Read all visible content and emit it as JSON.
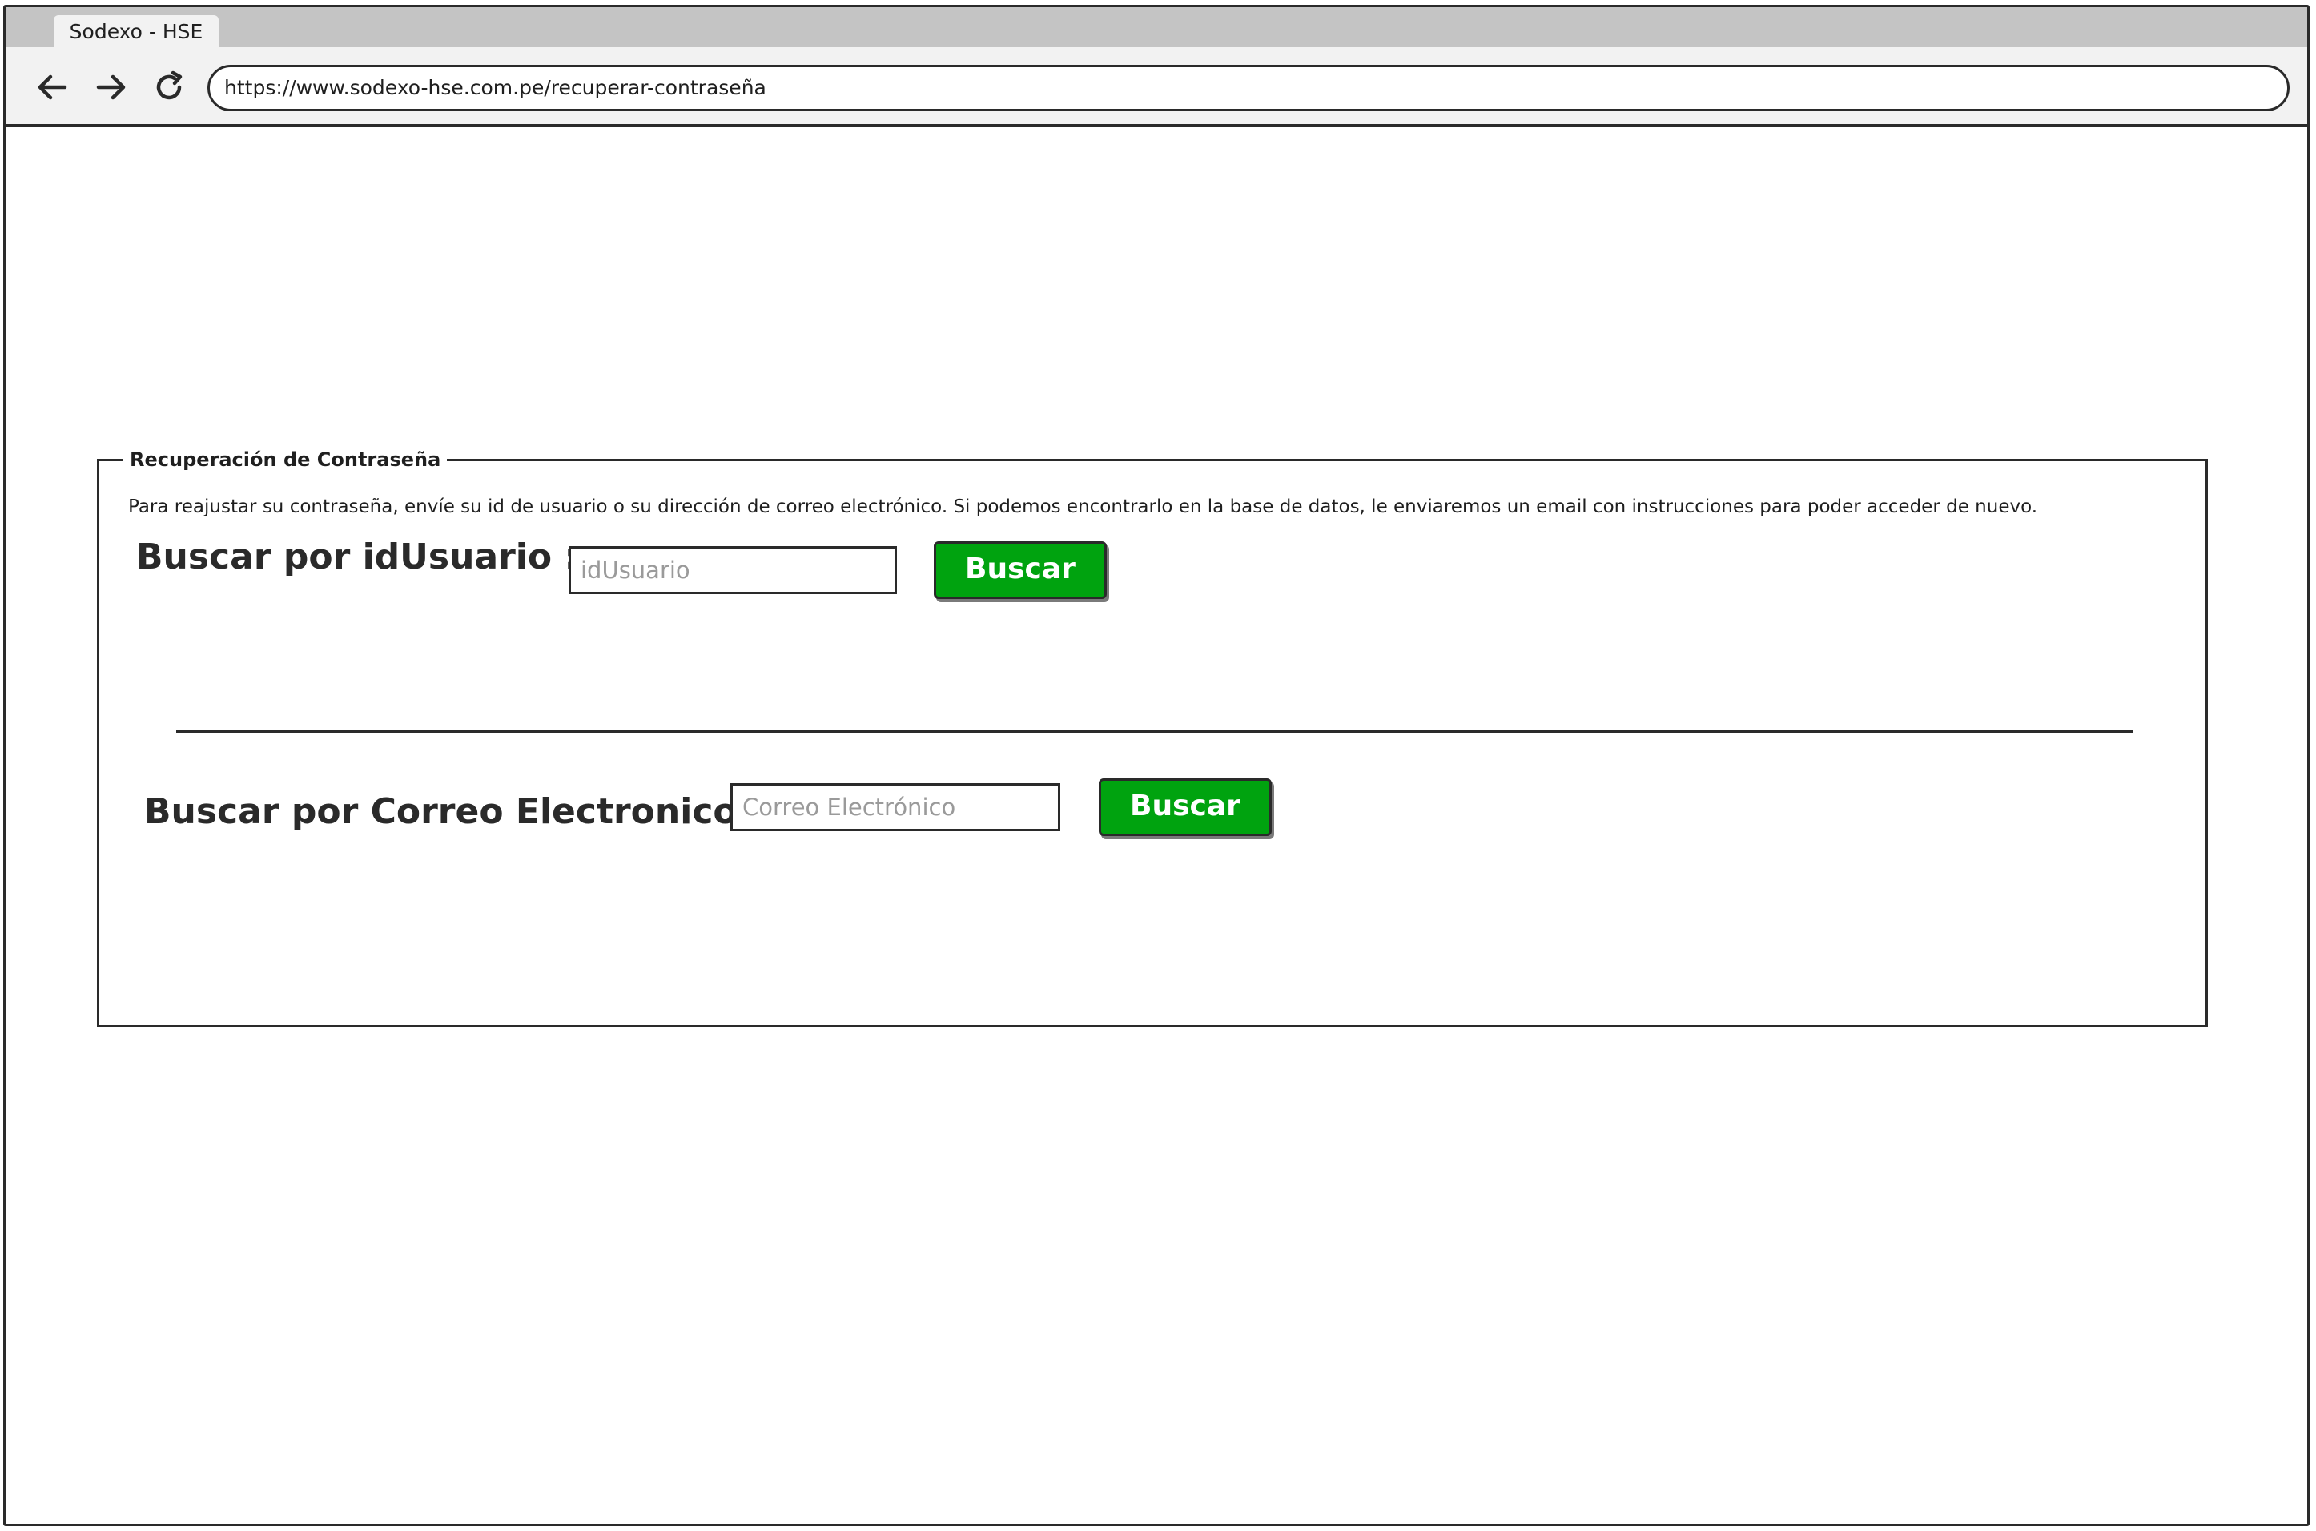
{
  "browser": {
    "tab_title": "Sodexo - HSE",
    "url": "https://www.sodexo-hse.com.pe/recuperar-contraseña",
    "back_icon": "arrow-left-icon",
    "forward_icon": "arrow-right-icon",
    "reload_icon": "reload-icon"
  },
  "form": {
    "legend": "Recuperación de Contraseña",
    "intro": "Para reajustar su contraseña, envíe su id de usuario o su dirección de correo electrónico. Si podemos encontrarlo en la base de datos, le enviaremos un email con instrucciones para poder acceder de nuevo.",
    "by_user": {
      "label": "Buscar por idUsuario :",
      "placeholder": "idUsuario",
      "button_label": "Buscar"
    },
    "by_email": {
      "label": "Buscar por Correo Electronico",
      "placeholder": "Correo Electrónico",
      "button_label": "Buscar"
    }
  },
  "colors": {
    "button_green": "#00a30f",
    "chrome_gray": "#c4c4c4",
    "toolbar_gray": "#f2f2f2"
  }
}
